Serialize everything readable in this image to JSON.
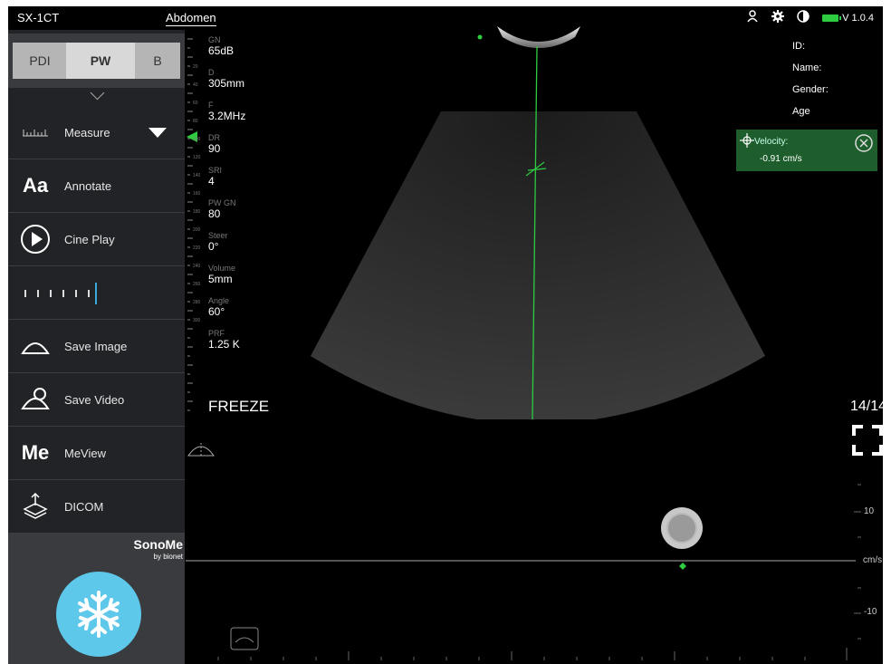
{
  "topbar": {
    "model": "SX-1CT",
    "preset": "Abdomen",
    "version": "V 1.0.4"
  },
  "mode_tabs": [
    "PDI",
    "PW",
    "B"
  ],
  "menu": {
    "measure": "Measure",
    "annotate": "Annotate",
    "annotate_glyph": "Aa",
    "cine_play": "Cine Play",
    "save_image": "Save Image",
    "save_video": "Save Video",
    "meview": "MeView",
    "meview_glyph": "Me",
    "dicom": "DICOM"
  },
  "brand": {
    "name": "SonoMe",
    "sub": "by bionet"
  },
  "params": [
    {
      "label": "GN",
      "value": "65dB"
    },
    {
      "label": "D",
      "value": "305mm"
    },
    {
      "label": "F",
      "value": "3.2MHz"
    },
    {
      "label": "DR",
      "value": "90"
    },
    {
      "label": "SRI",
      "value": "4"
    },
    {
      "label": "PW GN",
      "value": "80"
    },
    {
      "label": "Steer",
      "value": "0°"
    },
    {
      "label": "Volume",
      "value": "5mm"
    },
    {
      "label": "Angle",
      "value": "60°"
    },
    {
      "label": "PRF",
      "value": "1.25 K"
    }
  ],
  "ruler_labels": [
    "20",
    "40",
    "60",
    "80",
    "100",
    "120",
    "140",
    "160",
    "180",
    "200",
    "220",
    "240",
    "260",
    "280",
    "300"
  ],
  "freeze_label": "FREEZE",
  "patient": {
    "id": "ID:",
    "name": "Name:",
    "gender": "Gender:",
    "age": "Age"
  },
  "velocity": {
    "label": "Velocity:",
    "value": "-0.91 cm/s"
  },
  "frames": "14/14",
  "doppler_axis": {
    "top": "10",
    "unit": "cm/s",
    "bottom": "-10"
  },
  "colors": {
    "accent": "#5ec8ea",
    "doppler_line": "#2ecc40",
    "velocity_bg": "#1e5e2c"
  }
}
